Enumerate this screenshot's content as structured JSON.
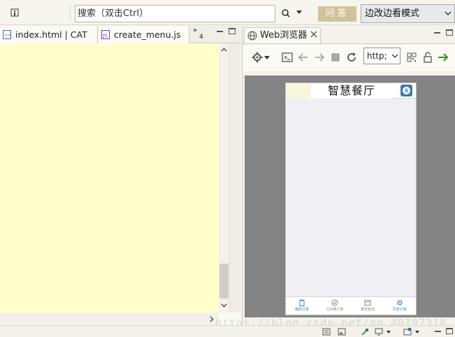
{
  "toolbar": {
    "search_placeholder": "搜索（双击Ctrl）",
    "ask_label": "问答",
    "mode_label": "边改边看模式"
  },
  "editor_tabs": [
    {
      "label": "index.html | CAT"
    },
    {
      "label": "create_menu.js"
    }
  ],
  "overflow_tabs": {
    "glyph": "»",
    "count": "4"
  },
  "browser": {
    "tab_label": "Web浏览器",
    "url": "http;"
  },
  "phone": {
    "title": "智慧餐厅",
    "tabs": [
      {
        "label": "我的订单",
        "active": true
      },
      {
        "label": "已点菜订单",
        "active": false
      },
      {
        "label": "菜单查询",
        "active": false
      },
      {
        "label": "历史订单",
        "active": true
      }
    ]
  },
  "watermark": "https://blog.csdn.net/qq_40197318",
  "colors": {
    "editor_bg": "#ffffcc",
    "ask_button": "#d2c29a",
    "phone_accent": "#2a7fd4",
    "go_arrow": "#3a8a2a"
  }
}
